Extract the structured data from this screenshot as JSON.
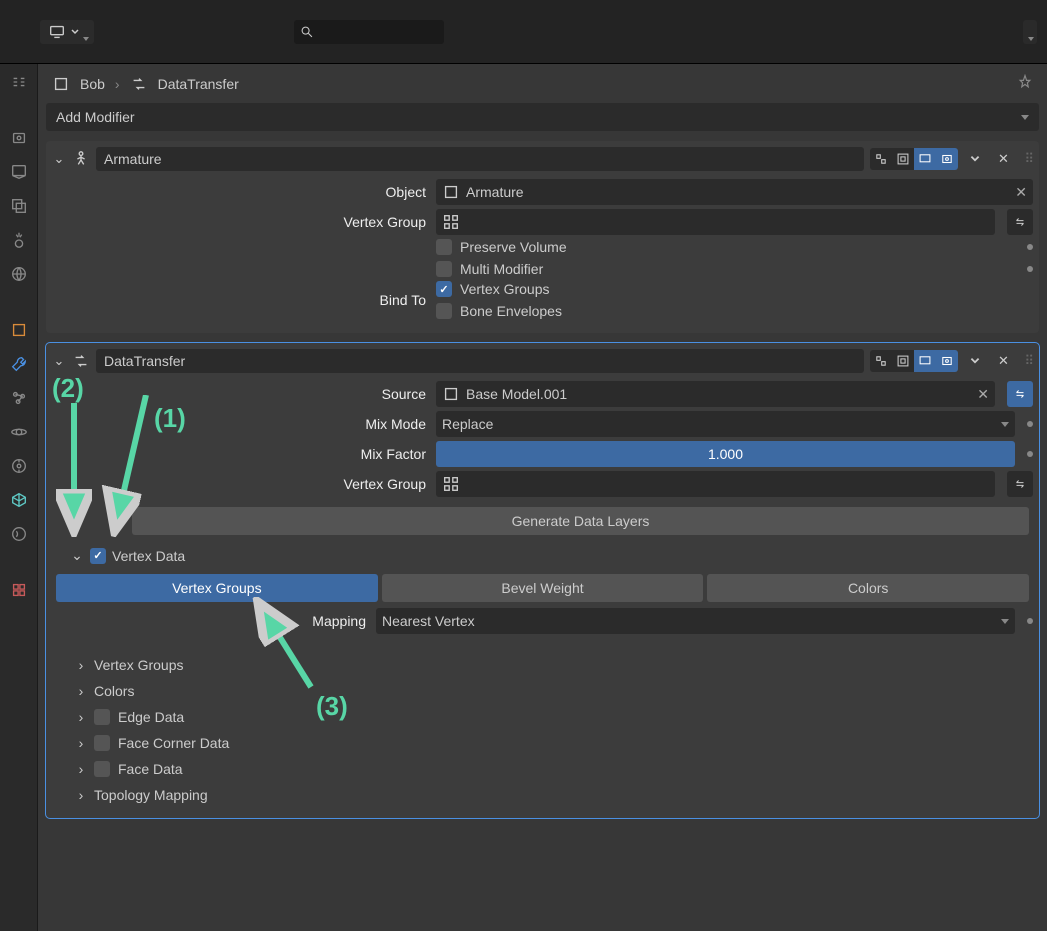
{
  "breadcrumb": {
    "object": "Bob",
    "modifier": "DataTransfer"
  },
  "add_modifier": "Add Modifier",
  "armature": {
    "title": "Armature",
    "object_label": "Object",
    "object_value": "Armature",
    "vgroup_label": "Vertex Group",
    "preserve_volume": "Preserve Volume",
    "multi_modifier": "Multi Modifier",
    "bind_label": "Bind To",
    "bind_vg": "Vertex Groups",
    "bind_env": "Bone Envelopes"
  },
  "dt": {
    "title": "DataTransfer",
    "source_label": "Source",
    "source_value": "Base Model.001",
    "mix_mode_label": "Mix Mode",
    "mix_mode_value": "Replace",
    "mix_factor_label": "Mix Factor",
    "mix_factor_value": "1.000",
    "vgroup_label": "Vertex Group",
    "gen_button": "Generate Data Layers",
    "vertex_data": "Vertex Data",
    "tabs": {
      "vg": "Vertex Groups",
      "bw": "Bevel Weight",
      "col": "Colors"
    },
    "mapping_label": "Mapping",
    "mapping_value": "Nearest Vertex",
    "subs": {
      "vg": "Vertex Groups",
      "colors": "Colors",
      "edge": "Edge Data",
      "fc": "Face Corner Data",
      "face": "Face Data",
      "topo": "Topology Mapping"
    }
  },
  "anno": {
    "l1": "(1)",
    "l2": "(2)",
    "l3": "(3)"
  }
}
